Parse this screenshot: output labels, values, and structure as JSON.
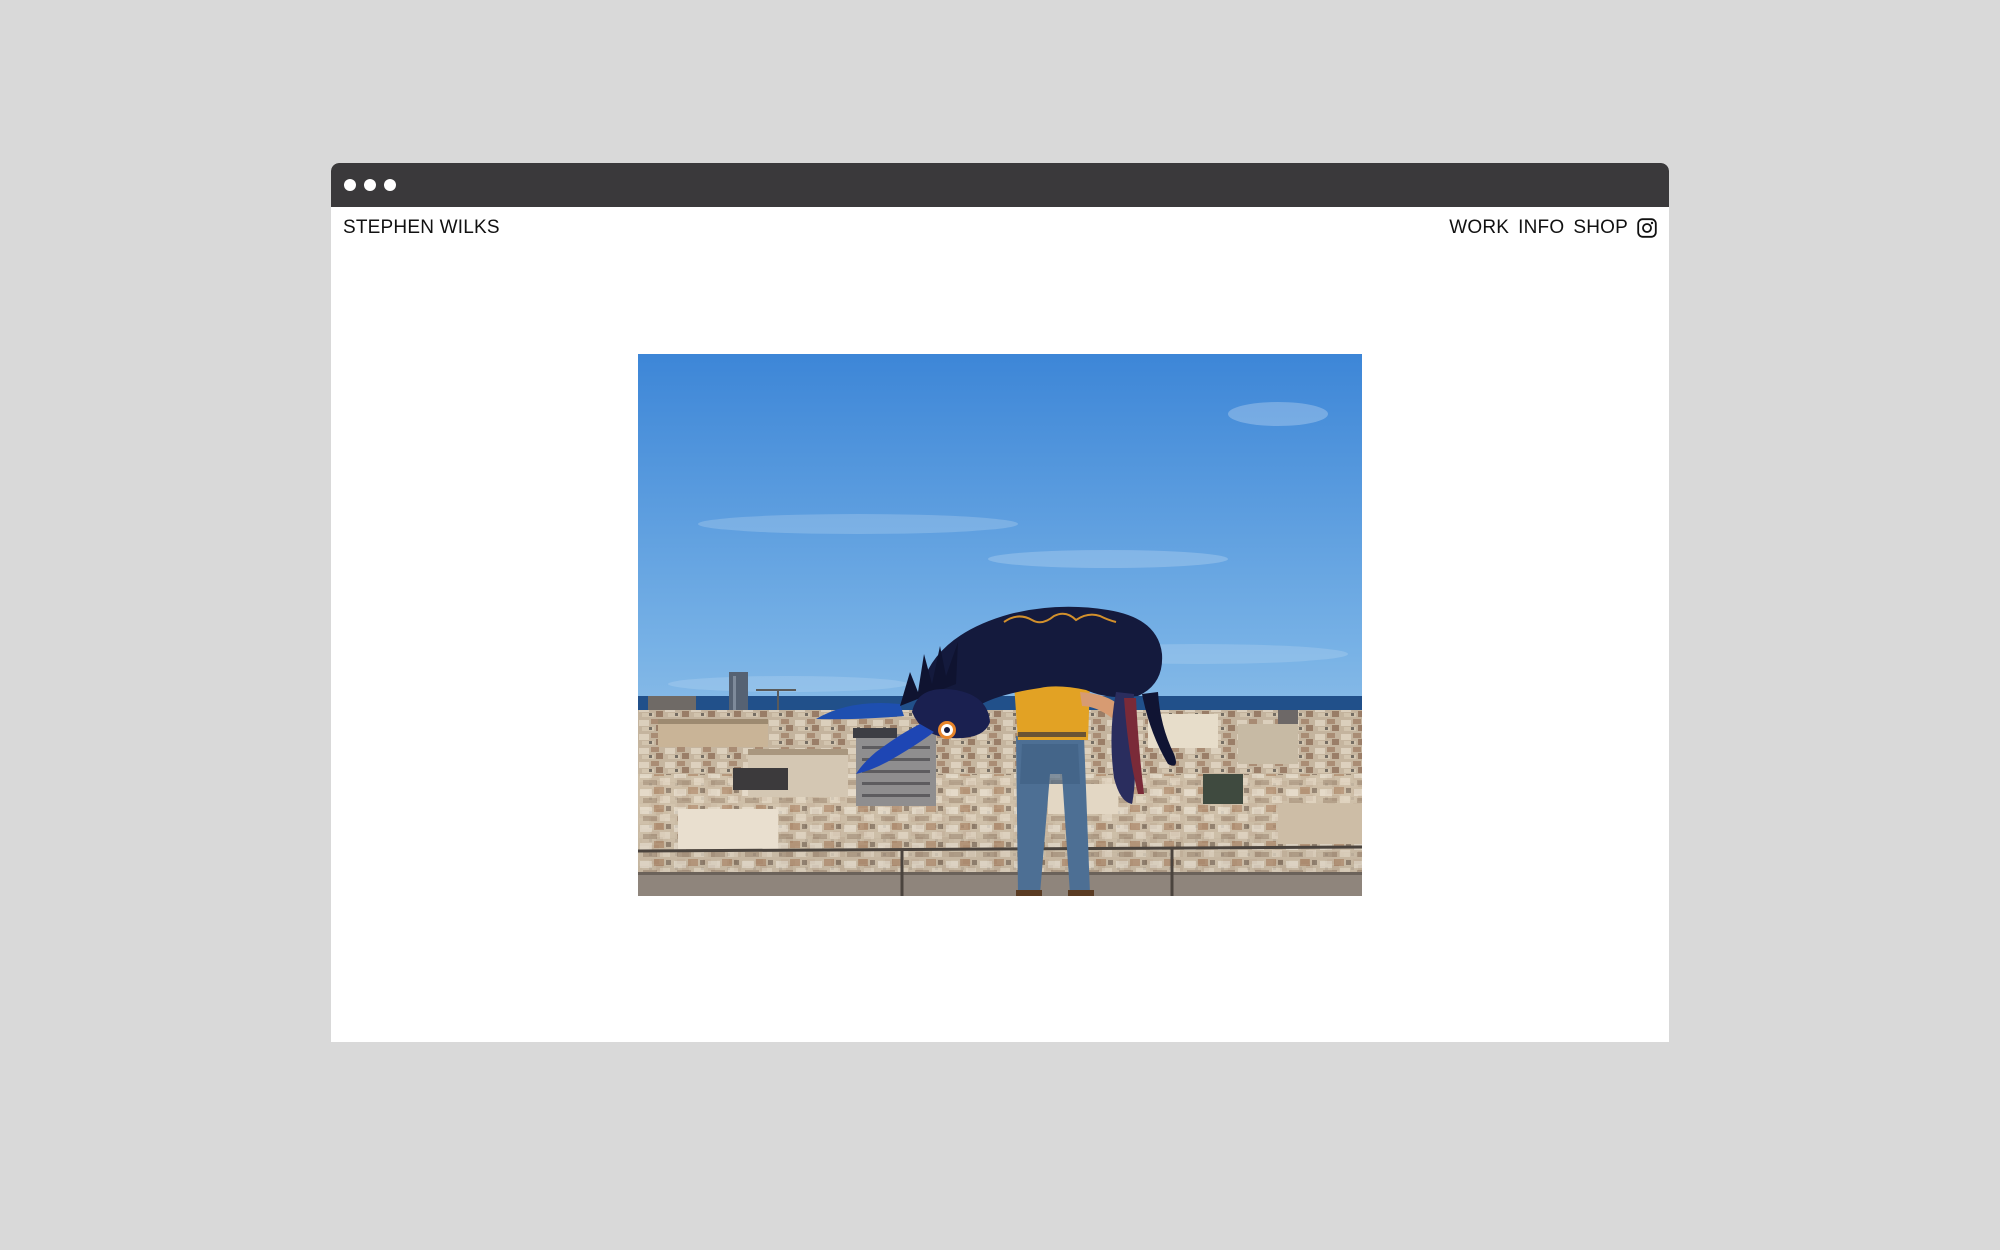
{
  "site": {
    "title": "STEPHEN WILKS"
  },
  "nav": {
    "items": [
      {
        "label": "WORK"
      },
      {
        "label": "INFO"
      },
      {
        "label": "SHOP"
      }
    ],
    "social_icon": "instagram-icon"
  },
  "window": {
    "controls": [
      "window-dot",
      "window-dot",
      "window-dot"
    ]
  },
  "colors": {
    "page_background": "#d9d9d9",
    "title_bar": "#3a393b",
    "content_background": "#ffffff",
    "text": "#111111"
  }
}
